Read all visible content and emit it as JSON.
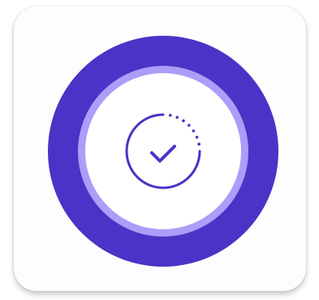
{
  "app_icon": {
    "icon": "check-circle-progress-icon",
    "colors": {
      "tile_background": "#fdfdfd",
      "outer_ring": "#4a33c6",
      "inner_ring": "#ad9cf8",
      "center_fill": "#ffffff",
      "glyph": "#4a33c6"
    }
  }
}
